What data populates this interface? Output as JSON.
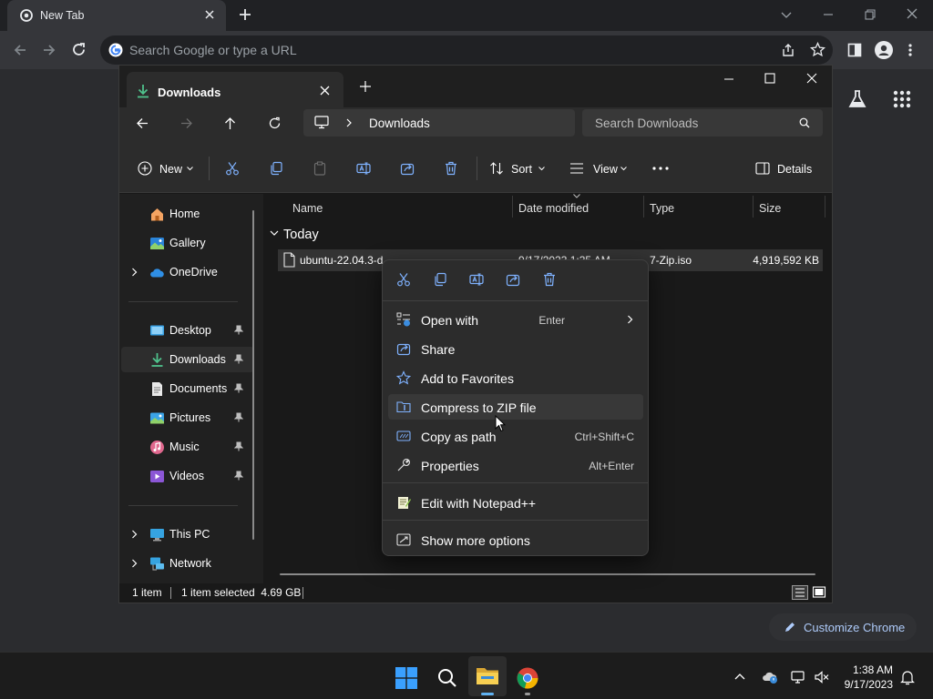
{
  "chrome": {
    "tab_title": "New Tab",
    "omnibox_placeholder": "Search Google or type a URL",
    "customize_label": "Customize Chrome"
  },
  "explorer": {
    "tab_title": "Downloads",
    "address_path": "Downloads",
    "search_placeholder": "Search Downloads",
    "commands": {
      "new_label": "New",
      "sort_label": "Sort",
      "view_label": "View",
      "details_label": "Details"
    },
    "sidebar": {
      "items": [
        {
          "label": "Home",
          "icon": "home-icon"
        },
        {
          "label": "Gallery",
          "icon": "gallery-icon"
        },
        {
          "label": "OneDrive",
          "icon": "onedrive-cloud-icon"
        },
        {
          "label": "Desktop",
          "icon": "desktop-folder-icon"
        },
        {
          "label": "Downloads",
          "icon": "downloads-folder-icon"
        },
        {
          "label": "Documents",
          "icon": "documents-folder-icon"
        },
        {
          "label": "Pictures",
          "icon": "pictures-folder-icon"
        },
        {
          "label": "Music",
          "icon": "music-folder-icon"
        },
        {
          "label": "Videos",
          "icon": "videos-folder-icon"
        },
        {
          "label": "This PC",
          "icon": "this-pc-icon"
        },
        {
          "label": "Network",
          "icon": "network-icon"
        }
      ]
    },
    "columns": {
      "name": "Name",
      "date_modified": "Date modified",
      "type": "Type",
      "size": "Size"
    },
    "group_label": "Today",
    "file": {
      "name": "ubuntu-22.04.3-d",
      "date": "9/17/2023 1:35 AM",
      "type": "7-Zip.iso",
      "size": "4,919,592 KB"
    },
    "status": {
      "count": "1 item",
      "selection": "1 item selected  4.69 GB"
    }
  },
  "context_menu": {
    "items": [
      {
        "label": "Open with",
        "shortcut": "Enter",
        "icon": "open-with-icon"
      },
      {
        "label": "Share",
        "shortcut": "",
        "icon": "share-icon"
      },
      {
        "label": "Add to Favorites",
        "shortcut": "",
        "icon": "star-icon"
      },
      {
        "label": "Compress to ZIP file",
        "shortcut": "",
        "icon": "zip-folder-icon"
      },
      {
        "label": "Copy as path",
        "shortcut": "Ctrl+Shift+C",
        "icon": "copy-path-icon"
      },
      {
        "label": "Properties",
        "shortcut": "Alt+Enter",
        "icon": "wrench-icon"
      },
      {
        "label": "Edit with Notepad++",
        "shortcut": "",
        "icon": "notepad-plus-plus-icon"
      },
      {
        "label": "Show more options",
        "shortcut": "",
        "icon": "more-options-icon"
      }
    ]
  },
  "taskbar": {
    "time": "1:38 AM",
    "date": "9/17/2023"
  },
  "colors": {
    "accent_blue": "#0078d4",
    "folder_yellow": "#f2c94c",
    "downloads_green": "#4fc28c"
  }
}
